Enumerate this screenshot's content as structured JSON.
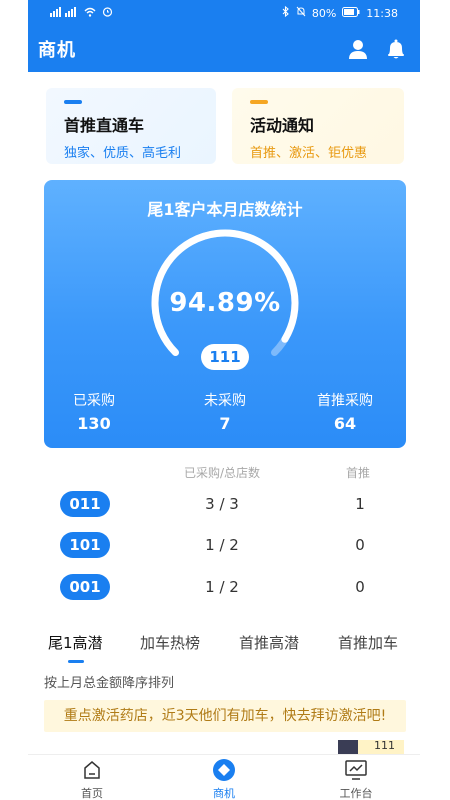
{
  "status_bar": {
    "battery": "80%",
    "time": "11:38"
  },
  "header": {
    "title": "商机",
    "icons": [
      "user-icon",
      "bell-icon"
    ]
  },
  "promo_cards": [
    {
      "title": "首推直通车",
      "subtitle": "独家、优质、高毛利",
      "accent": "#1a7ff0"
    },
    {
      "title": "活动通知",
      "subtitle": "首推、激活、钜优惠",
      "accent": "#f5a623"
    }
  ],
  "stats": {
    "title": "尾1客户本月店数统计",
    "percent_text": "94.89%",
    "progress": 0.9489,
    "total_badge": "111",
    "items": [
      {
        "label": "已采购",
        "value": "130"
      },
      {
        "label": "未采购",
        "value": "7"
      },
      {
        "label": "首推采购",
        "value": "64"
      }
    ]
  },
  "table": {
    "headers": [
      "已采购/总店数",
      "首推"
    ],
    "rows": [
      {
        "tag": "011",
        "ratio": "3 / 3",
        "first": "1"
      },
      {
        "tag": "101",
        "ratio": "1 / 2",
        "first": "0"
      },
      {
        "tag": "001",
        "ratio": "1 / 2",
        "first": "0"
      }
    ]
  },
  "tabs": [
    {
      "label": "尾1高潜",
      "active": true
    },
    {
      "label": "加车热榜",
      "active": false
    },
    {
      "label": "首推高潜",
      "active": false
    },
    {
      "label": "首推加车",
      "active": false
    }
  ],
  "sort_note": "按上月总金额降序排列",
  "notice": "重点激活药店，近3天他们有加车，快去拜访激活吧!",
  "peek_text": "111",
  "bottom_nav": [
    {
      "label": "首页",
      "icon": "home-icon"
    },
    {
      "label": "商机",
      "icon": "opportunity-icon",
      "active": true
    },
    {
      "label": "工作台",
      "icon": "dashboard-icon"
    }
  ],
  "colors": {
    "primary": "#1a7ff0",
    "notice_bg": "#fff7dd",
    "notice_text": "#b07b16"
  }
}
